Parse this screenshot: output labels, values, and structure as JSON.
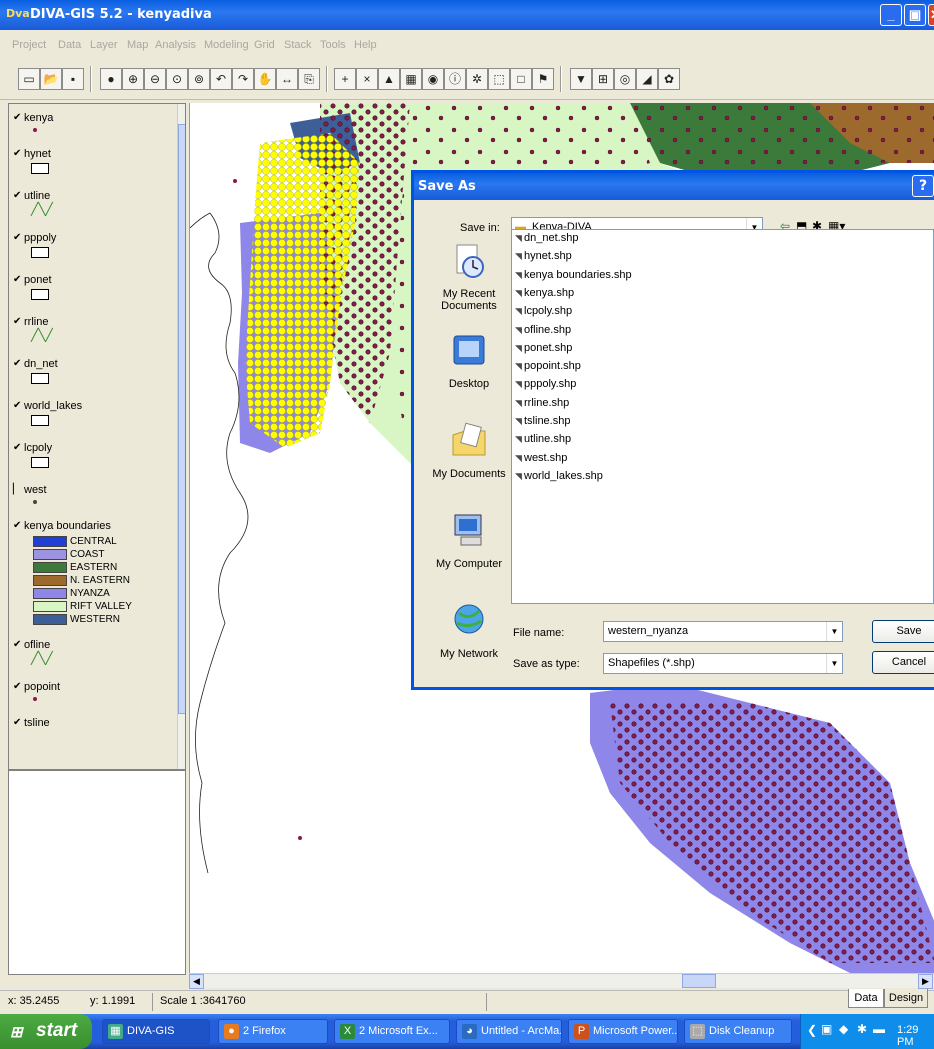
{
  "app": {
    "title": "DIVA-GIS 5.2 - kenyadiva",
    "icon_text": "Dva"
  },
  "menu": [
    "Project",
    "Data",
    "Layer",
    "Map",
    "Analysis",
    "Modeling",
    "Grid",
    "Stack",
    "Tools",
    "Help"
  ],
  "toolbar": [
    "new-icon",
    "open-icon",
    "save-icon",
    "globe-icon",
    "zoom-in-icon",
    "zoom-out-icon",
    "zoom-full-icon",
    "zoom-layer-icon",
    "undo-icon",
    "redo-icon",
    "pan-icon",
    "measure-icon",
    "copy-map-icon",
    "add-icon",
    "remove-icon",
    "select-icon",
    "table-icon",
    "point-icon",
    "info-icon",
    "tools-icon",
    "rect-icon",
    "square-icon",
    "flag-icon",
    "grid-icon",
    "target-icon",
    "paint-icon",
    "flower-icon"
  ],
  "legend": {
    "layers": [
      {
        "name": "kenya",
        "checked": true,
        "symbol": "dot",
        "color": "#8B1A4A"
      },
      {
        "name": "hynet",
        "checked": true,
        "symbol": "box"
      },
      {
        "name": "utline",
        "checked": true,
        "symbol": "line"
      },
      {
        "name": "pppoly",
        "checked": true,
        "symbol": "box"
      },
      {
        "name": "ponet",
        "checked": true,
        "symbol": "box"
      },
      {
        "name": "rrline",
        "checked": true,
        "symbol": "line"
      },
      {
        "name": "dn_net",
        "checked": true,
        "symbol": "box"
      },
      {
        "name": "world_lakes",
        "checked": true,
        "symbol": "box"
      },
      {
        "name": "lcpoly",
        "checked": true,
        "symbol": "box"
      },
      {
        "name": "west",
        "checked": false,
        "symbol": "dot",
        "color": "#444444"
      },
      {
        "name": "kenya boundaries",
        "checked": true,
        "symbol": "classes"
      },
      {
        "name": "ofline",
        "checked": true,
        "symbol": "line"
      },
      {
        "name": "popoint",
        "checked": true,
        "symbol": "dot",
        "color": "#8B1A4A"
      },
      {
        "name": "tsline",
        "checked": true,
        "symbol": "none"
      }
    ],
    "boundary_classes": [
      {
        "label": "CENTRAL",
        "color": "#1F3FD6"
      },
      {
        "label": "COAST",
        "color": "#9C94E0"
      },
      {
        "label": "EASTERN",
        "color": "#3C7A3C"
      },
      {
        "label": "N. EASTERN",
        "color": "#9C6A2C"
      },
      {
        "label": "NYANZA",
        "color": "#8E86E8"
      },
      {
        "label": "RIFT VALLEY",
        "color": "#D8F5C4"
      },
      {
        "label": "WESTERN",
        "color": "#3E5E98"
      }
    ]
  },
  "status": {
    "x": "x: 35.2455",
    "y": "y: 1.1991",
    "scale": "Scale 1 :3641760"
  },
  "tabs": {
    "data": "Data",
    "design": "Design"
  },
  "dialog": {
    "title": "Save As",
    "help": "?",
    "save_in_label": "Save in:",
    "save_in_value": "Kenya-DIVA",
    "places": [
      "My Recent Documents",
      "Desktop",
      "My Documents",
      "My Computer",
      "My Network"
    ],
    "files": [
      "dn_net.shp",
      "hynet.shp",
      "kenya boundaries.shp",
      "kenya.shp",
      "lcpoly.shp",
      "ofline.shp",
      "ponet.shp",
      "popoint.shp",
      "pppoly.shp",
      "rrline.shp",
      "tsline.shp",
      "utline.shp",
      "west.shp",
      "world_lakes.shp"
    ],
    "file_name_label": "File name:",
    "file_name_value": "western_nyanza",
    "save_type_label": "Save as type:",
    "save_type_value": "Shapefiles (*.shp)",
    "save_button": "Save",
    "cancel_button": "Cancel"
  },
  "taskbar": {
    "start": "start",
    "tasks": [
      "DIVA-GIS",
      "2 Firefox",
      "2 Microsoft Ex...",
      "Untitled - ArcMa...",
      "Microsoft Power...",
      "Disk Cleanup"
    ],
    "clock": "1:29 PM"
  },
  "map_colors": {
    "nyanza": "#8E86E8",
    "rift_valley": "#D8F5C4",
    "eastern": "#3C7A3C",
    "n_eastern": "#9C6A2C",
    "western": "#3E5E98",
    "points": "#8B1A4A",
    "highlight": "#FFFF00"
  }
}
